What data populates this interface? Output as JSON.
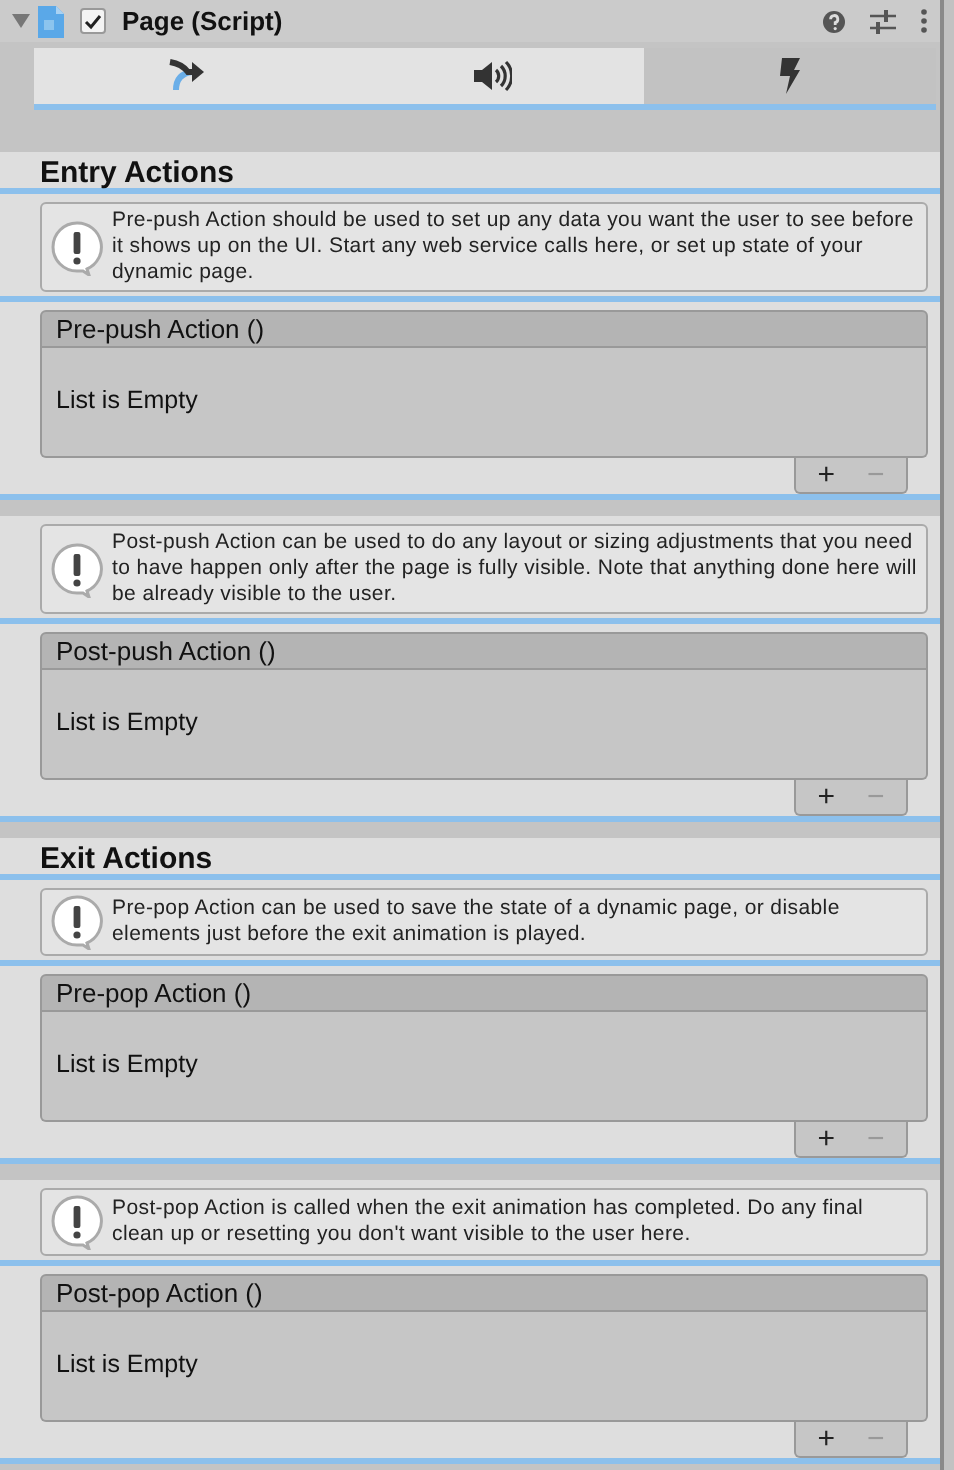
{
  "header": {
    "expanded": true,
    "enabled": true,
    "title": "Page (Script)"
  },
  "tabs": [
    {
      "kind": "transition",
      "selected": false
    },
    {
      "kind": "sound",
      "selected": false
    },
    {
      "kind": "event",
      "selected": true
    }
  ],
  "sections": [
    {
      "title": "Entry Actions",
      "blocks": [
        {
          "help": "Pre-push Action should be used to set up any data you want the user to see before it shows up on the UI. Start any web service calls here, or set up state of your dynamic page.",
          "event": {
            "title": "Pre-push Action ()",
            "empty_text": "List is Empty",
            "buttons": [
              {
                "label": "+",
                "disabled": false
              },
              {
                "label": "−",
                "disabled": true
              }
            ]
          }
        },
        {
          "help": "Post-push Action can be used to do any layout or sizing adjustments that you need to have happen only after the page is fully visible. Note that anything done here will be already visible to the user.",
          "event": {
            "title": "Post-push Action ()",
            "empty_text": "List is Empty",
            "buttons": [
              {
                "label": "+",
                "disabled": false
              },
              {
                "label": "−",
                "disabled": true
              }
            ]
          }
        }
      ]
    },
    {
      "title": "Exit Actions",
      "blocks": [
        {
          "help": "Pre-pop Action can be used to save the state of a dynamic page, or disable elements just before the exit animation is played.",
          "event": {
            "title": "Pre-pop Action ()",
            "empty_text": "List is Empty",
            "buttons": [
              {
                "label": "+",
                "disabled": false
              },
              {
                "label": "−",
                "disabled": true
              }
            ]
          }
        },
        {
          "help": "Post-pop Action is called when the exit animation has completed. Do any final clean up or resetting you don't want visible to the user here.",
          "event": {
            "title": "Post-pop Action ()",
            "empty_text": "List is Empty",
            "buttons": [
              {
                "label": "+",
                "disabled": false
              },
              {
                "label": "−",
                "disabled": true
              }
            ]
          }
        }
      ]
    }
  ]
}
